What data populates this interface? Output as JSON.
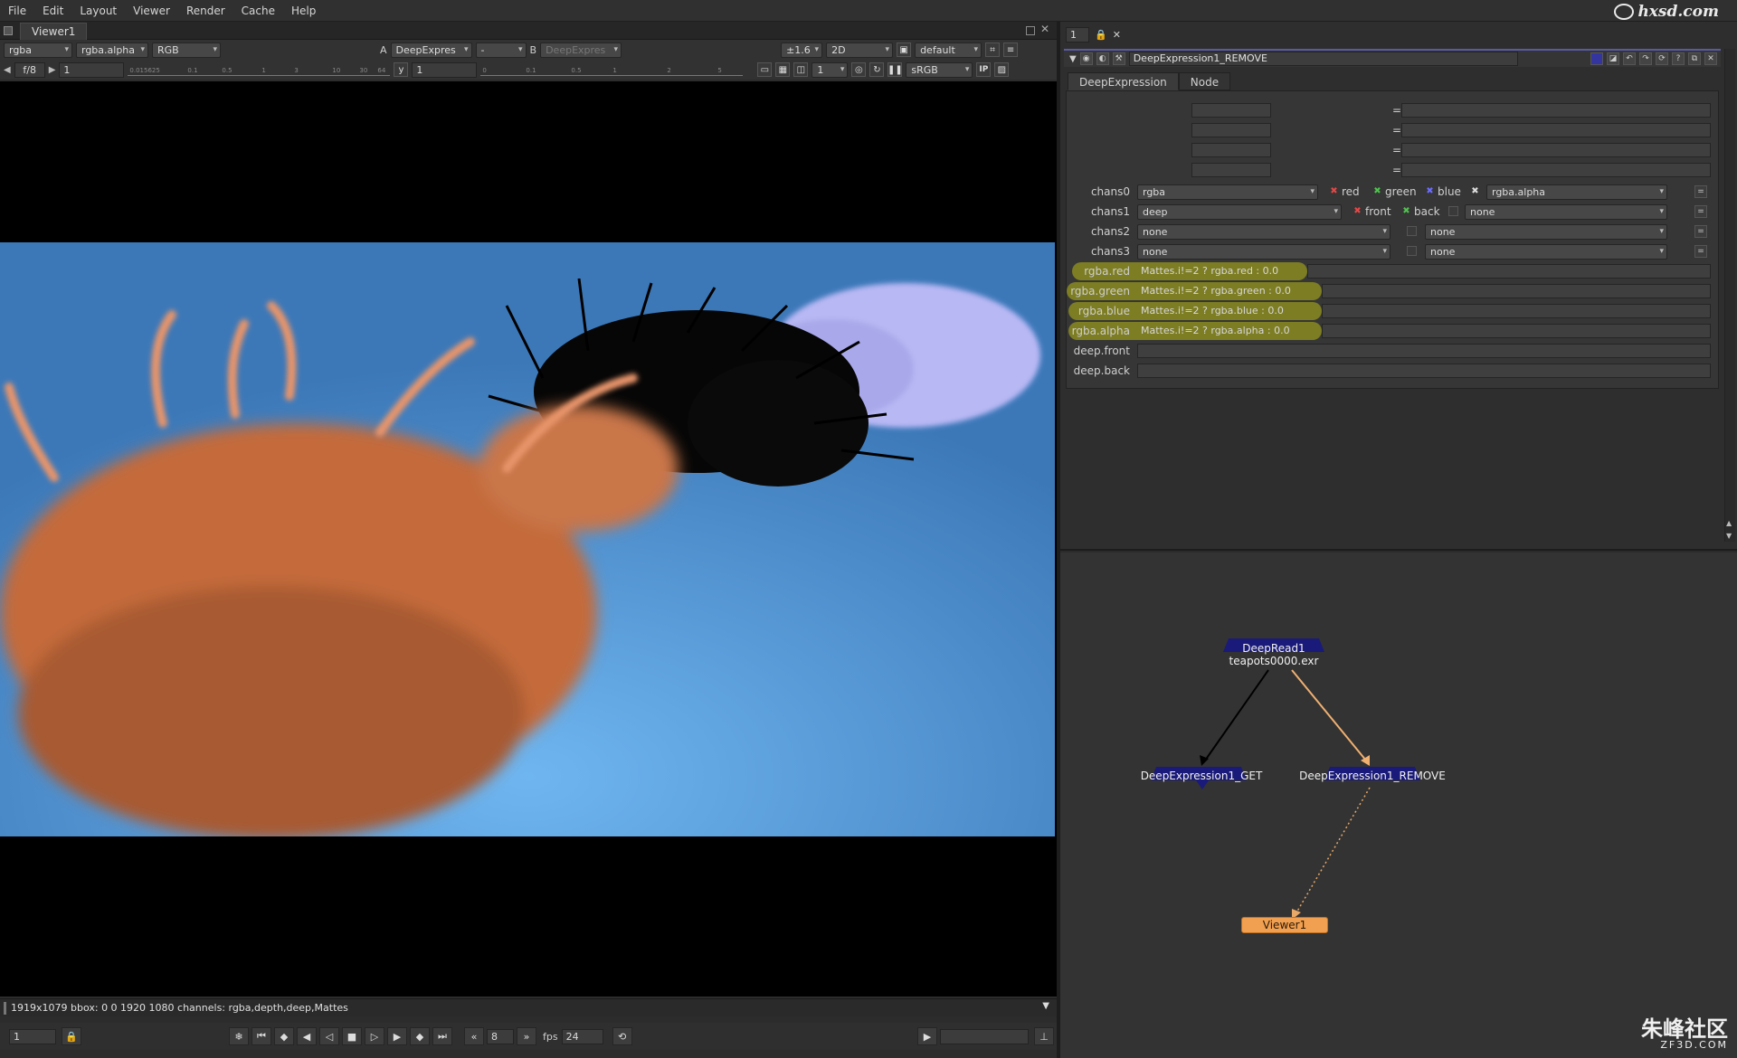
{
  "menu": [
    "File",
    "Edit",
    "Layout",
    "Viewer",
    "Render",
    "Cache",
    "Help"
  ],
  "brand_logo": "hxsd.com",
  "viewer": {
    "tab_title": "Viewer1",
    "toolbar1": {
      "channels": "rgba",
      "alpha_channel": "rgba.alpha",
      "display_mode": "RGB",
      "input_a_label": "A",
      "input_a": "DeepExpres",
      "composite_op": "-",
      "input_b_label": "B",
      "input_b": "DeepExpres",
      "zoom": "±1.6",
      "view_mode": "2D",
      "lut": "default"
    },
    "toolbar2": {
      "fstop": "f/8",
      "gain_value": "1",
      "gain_ticks": [
        "0.015625",
        "0.1",
        "0.5",
        "1",
        "3",
        "10",
        "30",
        "64"
      ],
      "gamma_label": "y",
      "gamma_value": "1",
      "gamma_ticks": [
        "0",
        "0.1",
        "0.5",
        "1",
        "2",
        "5"
      ],
      "proxy_scale": "1",
      "colorspace": "sRGB",
      "ip_label": "IP"
    },
    "info_text": "1919x1079 bbox: 0 0 1920 1080 channels: rgba,depth,deep,Mattes",
    "transport": {
      "frame": "1",
      "step": "8",
      "fps_label": "fps",
      "fps": "24"
    }
  },
  "properties": {
    "panel_count": "1",
    "node_name": "DeepExpression1_REMOVE",
    "tabs": [
      "DeepExpression",
      "Node"
    ],
    "eq_sign": "=",
    "chans": [
      {
        "label": "chans0",
        "layer": "rgba",
        "channels": [
          {
            "mark": "✖",
            "name": "red",
            "color": "#e24848"
          },
          {
            "mark": "✖",
            "name": "green",
            "color": "#4fc24f"
          },
          {
            "mark": "✖",
            "name": "blue",
            "color": "#6c6cff"
          },
          {
            "mark": "✖",
            "name": "",
            "color": "#dddddd"
          }
        ],
        "extra": "rgba.alpha"
      },
      {
        "label": "chans1",
        "layer": "deep",
        "channels": [
          {
            "mark": "✖",
            "name": "front",
            "color": "#e24848"
          },
          {
            "mark": "✖",
            "name": "back",
            "color": "#4fc24f"
          }
        ],
        "extra": "none"
      },
      {
        "label": "chans2",
        "layer": "none",
        "extra": "none"
      },
      {
        "label": "chans3",
        "layer": "none",
        "extra": "none"
      }
    ],
    "expressions": [
      {
        "label": "rgba.red",
        "expr": "Mattes.i!=2 ? rgba.red : 0.0"
      },
      {
        "label": "rgba.green",
        "expr": "Mattes.i!=2 ? rgba.green : 0.0"
      },
      {
        "label": "rgba.blue",
        "expr": "Mattes.i!=2 ? rgba.blue : 0.0"
      },
      {
        "label": "rgba.alpha",
        "expr": "Mattes.i!=2 ? rgba.alpha : 0.0"
      },
      {
        "label": "deep.front",
        "expr": ""
      },
      {
        "label": "deep.back",
        "expr": ""
      }
    ],
    "highlight_color": "#96961e"
  },
  "graph": {
    "nodes": {
      "deepread_name": "DeepRead1",
      "deepread_file": "teapots0000.exr",
      "get": "DeepExpression1_GET",
      "remove": "DeepExpression1_REMOVE",
      "viewer": "Viewer1"
    },
    "wire_colors": {
      "to_get": "#000000",
      "to_remove": "#f0b070",
      "to_viewer": "#e8a868"
    }
  },
  "watermark": {
    "text": "朱峰社区",
    "sub": "ZF3D.COM"
  }
}
